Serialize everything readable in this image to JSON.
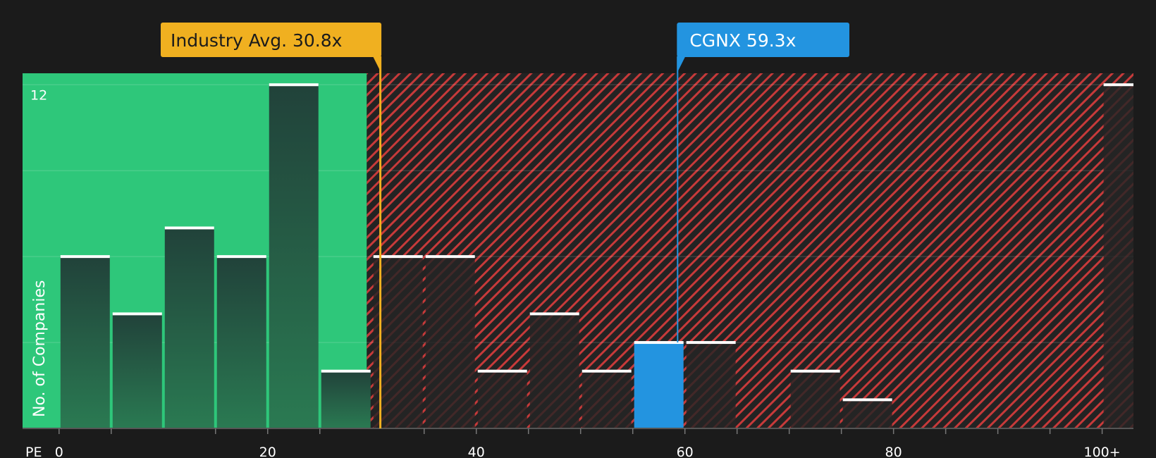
{
  "chart_data": {
    "type": "bar",
    "xlabel": "PE",
    "ylabel": "No. of Companies",
    "xlim": [
      -3.5,
      103
    ],
    "ylim": [
      0,
      12.4
    ],
    "x_ticks": [
      {
        "value": 0,
        "label": "0"
      },
      {
        "value": 20,
        "label": "20"
      },
      {
        "value": 40,
        "label": "40"
      },
      {
        "value": 60,
        "label": "60"
      },
      {
        "value": 80,
        "label": "80"
      },
      {
        "value": 100,
        "label": "100+"
      }
    ],
    "minor_x_ticks": [
      5,
      15,
      25,
      35,
      45,
      50,
      55,
      65,
      70,
      75,
      85,
      90,
      95
    ],
    "y_ticks": [
      {
        "value": 12,
        "label": "12"
      }
    ],
    "y_gridlines": [
      3,
      6,
      9,
      12
    ],
    "bin_width": 5,
    "bins": [
      {
        "start": 0,
        "count": 6
      },
      {
        "start": 5,
        "count": 4
      },
      {
        "start": 10,
        "count": 7
      },
      {
        "start": 15,
        "count": 6
      },
      {
        "start": 20,
        "count": 12
      },
      {
        "start": 25,
        "count": 2
      },
      {
        "start": 30,
        "count": 6
      },
      {
        "start": 35,
        "count": 6
      },
      {
        "start": 40,
        "count": 2
      },
      {
        "start": 45,
        "count": 4
      },
      {
        "start": 50,
        "count": 2
      },
      {
        "start": 55,
        "count": 3,
        "highlight": true
      },
      {
        "start": 60,
        "count": 3
      },
      {
        "start": 65,
        "count": 0
      },
      {
        "start": 70,
        "count": 2
      },
      {
        "start": 75,
        "count": 1
      },
      {
        "start": 80,
        "count": 0
      },
      {
        "start": 85,
        "count": 0
      },
      {
        "start": 90,
        "count": 0
      },
      {
        "start": 95,
        "count": 0
      },
      {
        "start": 100,
        "count": 12
      }
    ],
    "fair_range_end": 29.5,
    "industry_avg": {
      "value": 30.8,
      "label": "Industry Avg. 30.8x",
      "color": "#f0b020"
    },
    "company": {
      "value": 59.3,
      "label": "CGNX 59.3x",
      "color": "#2394e0"
    },
    "colors": {
      "background": "#1b1b1b",
      "fair_zone": "#2ec77a",
      "overvalued_zone": "#c73a3a",
      "bar_top": "#21423a",
      "bar_bottom": "#2a7a52",
      "highlight_bar": "#2394e0",
      "cap": "#ffffff"
    }
  }
}
